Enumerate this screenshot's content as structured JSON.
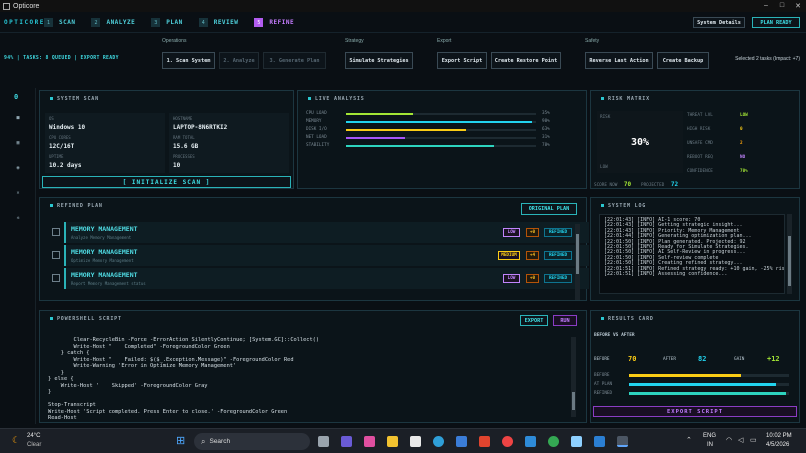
{
  "window": {
    "title": "Opticore",
    "controls": [
      "–",
      "□",
      "✕"
    ]
  },
  "brand": "OPTICORE",
  "steps": [
    {
      "num": "1",
      "label": "SCAN"
    },
    {
      "num": "2",
      "label": "ANALYZE"
    },
    {
      "num": "3",
      "label": "PLAN"
    },
    {
      "num": "4",
      "label": "REVIEW"
    },
    {
      "num": "5",
      "label": "REFINE"
    }
  ],
  "header_buttons": {
    "details": "System Details",
    "ready": "PLAN READY"
  },
  "status": "94% | TASKS: 8 QUEUED | EXPORT READY",
  "groups": {
    "operations": {
      "label": "Operations",
      "buttons": [
        "1. Scan System",
        "2. Analyze",
        "3. Generate Plan"
      ]
    },
    "strategy": {
      "label": "Strategy",
      "buttons": [
        "Simulate Strategies"
      ]
    },
    "export": {
      "label": "Export",
      "buttons": [
        "Export Script",
        "Create Restore Point"
      ]
    },
    "safety": {
      "label": "Safety",
      "buttons": [
        "Reverse Last Action",
        "Create Backup"
      ]
    }
  },
  "selected_info": "Selected 2 tasks (Impact: +7)",
  "rail": {
    "counter": "0",
    "icons": [
      "square-icon",
      "grid-icon",
      "gauge-icon",
      "x-icon",
      "gear-icon"
    ]
  },
  "system_scan": {
    "title": "SYSTEM SCAN",
    "fields": [
      {
        "k": "OS",
        "v": "Windows 10"
      },
      {
        "k": "HOSTNAME",
        "v": "LAPTOP-8N6RTKI2"
      },
      {
        "k": "CPU CORES",
        "v": "12C/16T"
      },
      {
        "k": "RAM TOTAL",
        "v": "15.6 GB"
      },
      {
        "k": "UPTIME",
        "v": "10.2 days"
      },
      {
        "k": "PROCESSES",
        "v": "10"
      }
    ],
    "button": "[ INITIALIZE SCAN ]"
  },
  "live_analysis": {
    "title": "LIVE ANALYSIS",
    "bars": [
      {
        "label": "CPU LOAD",
        "pct": "35%",
        "value": 0.35,
        "color": "#a3e635"
      },
      {
        "label": "MEMORY",
        "pct": "98%",
        "value": 0.98,
        "color": "#22d3ee"
      },
      {
        "label": "DISK I/O",
        "pct": "63%",
        "value": 0.63,
        "color": "#facc15"
      },
      {
        "label": "NET LOAD",
        "pct": "31%",
        "value": 0.31,
        "color": "#a855f7"
      },
      {
        "label": "STABILITY",
        "pct": "78%",
        "value": 0.78,
        "color": "#2dd4bf"
      }
    ]
  },
  "risk_matrix": {
    "title": "RISK MATRIX",
    "risk_label": "RISK",
    "risk_value": "30%",
    "low_label": "LOW",
    "rows": [
      {
        "k": "THREAT LVL",
        "v": "LOW",
        "color": "#a3e635"
      },
      {
        "k": "HIGH RISK",
        "v": "0",
        "color": "#facc15"
      },
      {
        "k": "UNSAFE CMD",
        "v": "2",
        "color": "#f59e0b"
      },
      {
        "k": "REBOOT REQ",
        "v": "NO",
        "color": "#c084fc"
      },
      {
        "k": "CONFIDENCE",
        "v": "70%",
        "color": "#a3e635"
      }
    ],
    "score_now_label": "SCORE NOW",
    "score_now": "70",
    "projected_label": "PROJECTED",
    "projected": "72"
  },
  "refined_plan": {
    "title": "REFINED PLAN",
    "button": "ORIGINAL PLAN",
    "items": [
      {
        "title": "MEMORY MANAGEMENT",
        "sub": "Analyze Memory Management",
        "level": "LOW",
        "level_color": "#c084fc",
        "impact": "+0",
        "status": "REFINED"
      },
      {
        "title": "MEMORY MANAGEMENT",
        "sub": "Optimize Memory Management",
        "level": "MEDIUM",
        "level_color": "#facc15",
        "impact": "+4",
        "status": "REFINED"
      },
      {
        "title": "MEMORY MANAGEMENT",
        "sub": "Report Memory Management status",
        "level": "LOW",
        "level_color": "#c084fc",
        "impact": "+0",
        "status": "REFINED"
      }
    ]
  },
  "system_log": {
    "title": "SYSTEM LOG",
    "lines": [
      "[22:01:43] [INFO] AI-1 score: 70",
      "[22:01:43] [INFO] Getting strategic insight...",
      "[22:01:43] [INFO] Priority: Memory Management",
      "[22:01:44] [INFO] Generating optimization plan...",
      "[22:01:50] [INFO] Plan generated. Projected: 92",
      "[22:01:50] [INFO] Ready for Simulate Strategies.",
      "[22:01:50] [INFO] AI Self-Review in progress...",
      "[22:01:50] [INFO] Self-review complete",
      "[22:01:50] [INFO] Creating refined strategy...",
      "[22:01:51] [INFO] Refined strategy ready: +10 gain, -25% risk",
      "[22:01:51] [INFO] Assessing confidence..."
    ]
  },
  "powershell": {
    "title": "POWERSHELL SCRIPT",
    "export": "EXPORT",
    "run": "RUN",
    "code": "        Clear-RecycleBin -Force -ErrorAction SilentlyContinue; [System.GC]::Collect()\n        Write-Host \"    Completed\" -ForegroundColor Green\n    } catch {\n        Write-Host \"    Failed: $($_.Exception.Message)\" -ForegroundColor Red\n        Write-Warning 'Error in Optimize Memory Management'\n    }\n} else {\n    Write-Host '    Skipped' -ForegroundColor Gray\n}\n\nStop-Transcript\nWrite-Host 'Script completed. Press Enter to close.' -ForegroundColor Green\nRead-Host"
  },
  "results": {
    "title": "RESULTS CARD",
    "subtitle": "BEFORE VS AFTER",
    "before_label": "BEFORE",
    "before": "70",
    "after_label": "AFTER",
    "after": "82",
    "gain_label": "GAIN",
    "gain": "+12",
    "bars": [
      {
        "label": "BEFORE",
        "value": 0.7,
        "color": "#facc15"
      },
      {
        "label": "AT PLAN",
        "value": 0.92,
        "color": "#22d3ee"
      },
      {
        "label": "REFINED",
        "value": 0.98,
        "color": "#2dd4bf"
      }
    ],
    "button": "EXPORT SCRIPT"
  },
  "taskbar": {
    "weather_temp": "24°C",
    "weather_desc": "Clear",
    "search": "Search",
    "lang1": "ENG",
    "lang2": "IN",
    "time": "10:02 PM",
    "date": "4/5/2026"
  }
}
